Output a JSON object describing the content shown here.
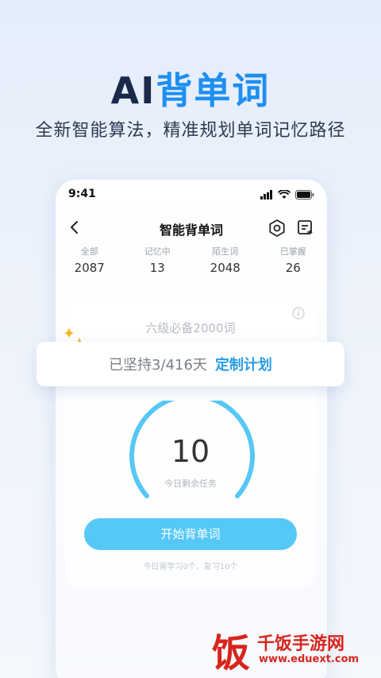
{
  "promo": {
    "headline_ai": "AI",
    "headline_rest": "背单词",
    "subline": "全新智能算法，精准规划单词记忆路径"
  },
  "status_bar": {
    "time": "9:41"
  },
  "nav": {
    "title": "智能背单词"
  },
  "stats": [
    {
      "label": "全部",
      "value": "2087"
    },
    {
      "label": "记忆中",
      "value": "13"
    },
    {
      "label": "陌生词",
      "value": "2048"
    },
    {
      "label": "已掌握",
      "value": "26"
    }
  ],
  "plan": {
    "title": "六级必备2000词",
    "banner_text": "已坚持3/416天",
    "banner_link": "定制计划",
    "remaining_count": "10",
    "remaining_label": "今日剩余任务",
    "start_button": "开始背单词",
    "today_note": "今日需学习0个，复习10个"
  },
  "watermark": {
    "logo_char": "饭",
    "title": "千饭手游网",
    "url": "www.eduext.com"
  },
  "colors": {
    "accent": "#1e8ff0",
    "button": "#56c8f6",
    "gauge": "#56c8f6",
    "watermark": "#d8241c"
  }
}
